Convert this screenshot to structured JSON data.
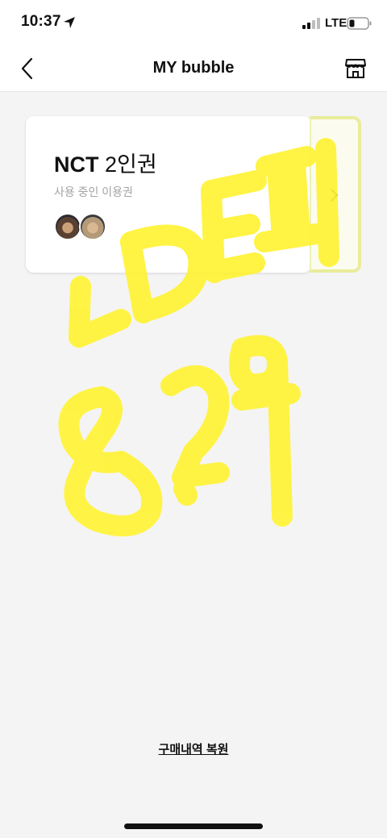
{
  "status_bar": {
    "time": "10:37",
    "network": "LTE",
    "icons": [
      "location-arrow-icon",
      "signal-icon",
      "battery-icon"
    ]
  },
  "header": {
    "title": "MY bubble",
    "icons": [
      "back-icon",
      "store-icon"
    ]
  },
  "ticket": {
    "brand": "NCT",
    "plan": " 2인권",
    "status": "사용 중인 이용권",
    "avatar_count": 2,
    "stub_icon": "chevron-right-icon",
    "stub_color": "#e9ec9a"
  },
  "overlay": {
    "type": "handwritten-marker",
    "color": "#fff335"
  },
  "footer": {
    "restore_label": "구매내역 복원"
  }
}
